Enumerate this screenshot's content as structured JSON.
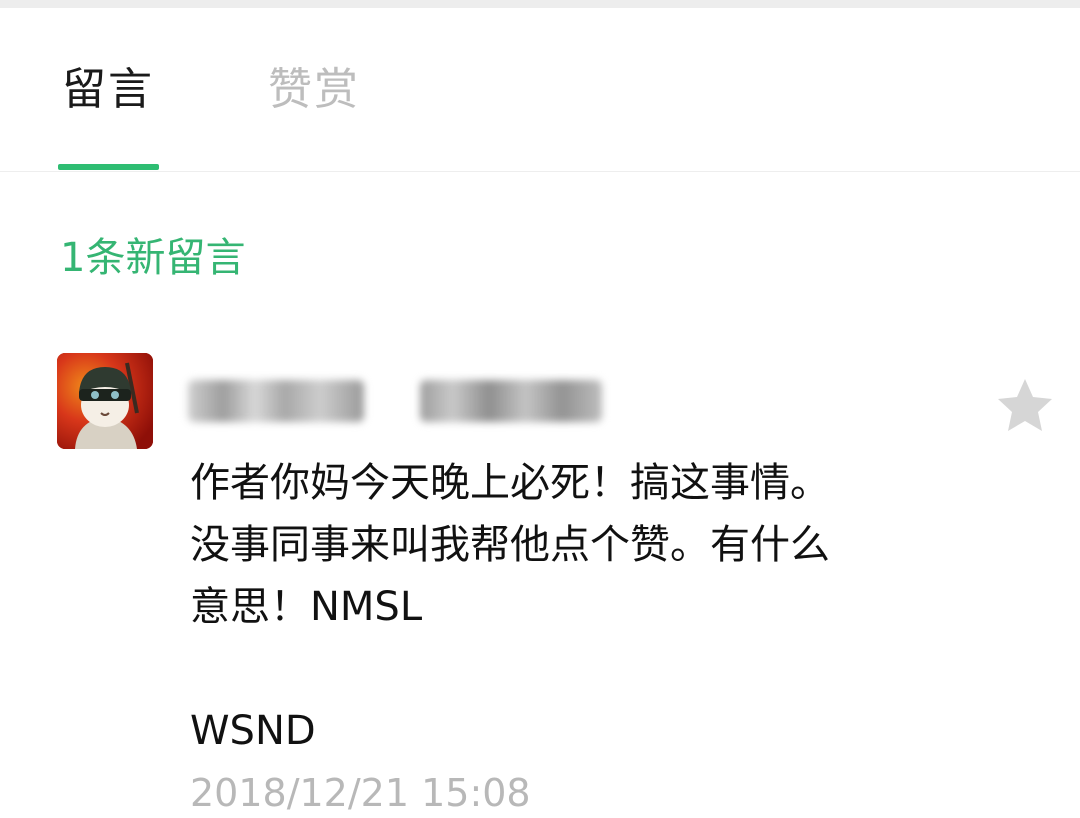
{
  "tabs": [
    {
      "label": "留言",
      "active": true
    },
    {
      "label": "赞赏",
      "active": false
    }
  ],
  "accent_color": "#2ebd72",
  "comments_section": {
    "new_count_label": "1条新留言"
  },
  "comment": {
    "avatar_icon": "game-character-avatar",
    "nickname_blurred": true,
    "star_icon": "star-icon",
    "lines": [
      "作者你妈今天晚上必死！搞这事情。",
      "没事同事来叫我帮他点个赞。有什么",
      "意思！NMSL",
      "",
      "WSND"
    ],
    "timestamp": "2018/12/21 15:08"
  }
}
